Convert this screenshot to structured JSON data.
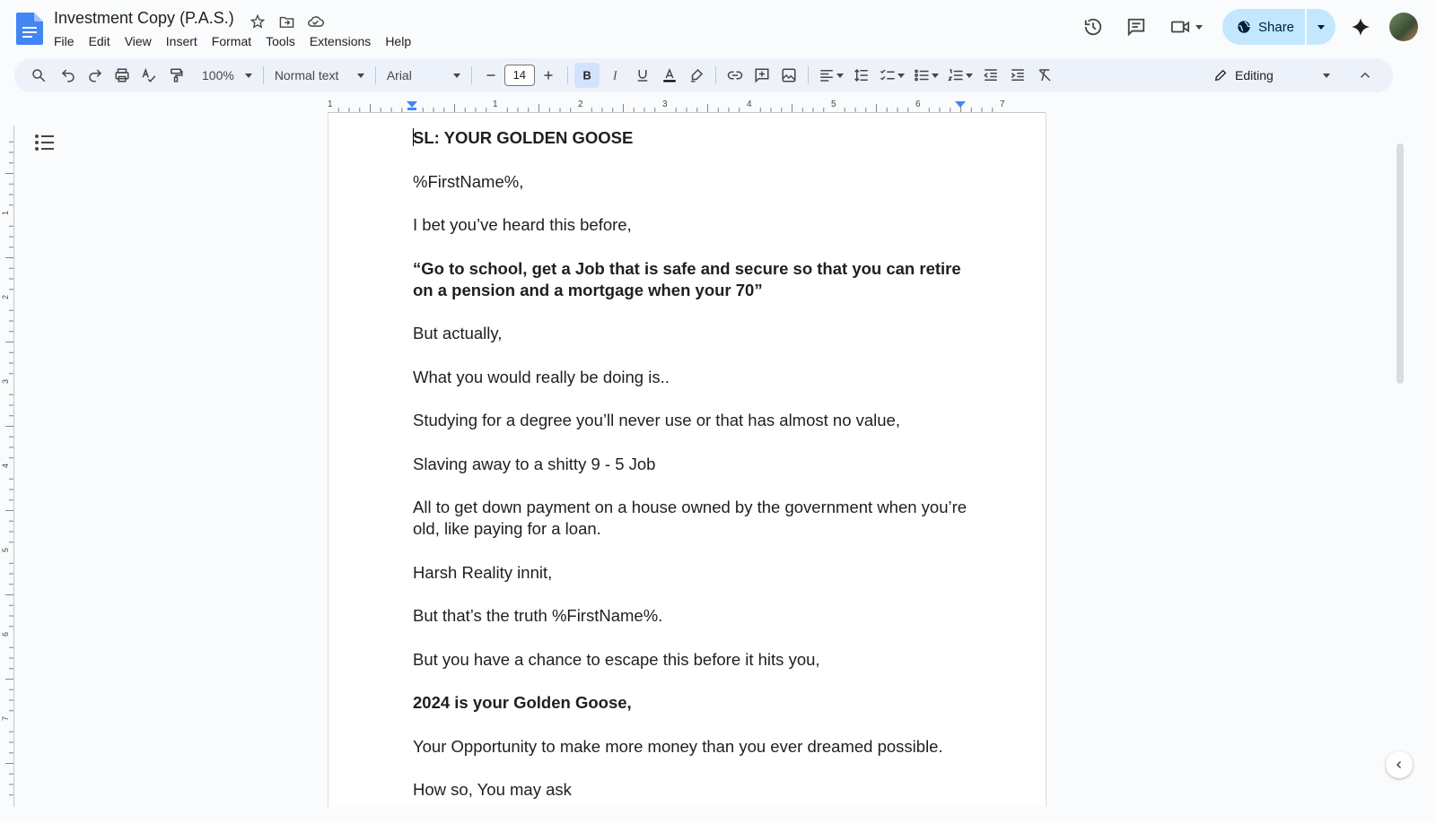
{
  "app": {
    "doc_title": "Investment Copy (P.A.S.)",
    "menu": [
      "File",
      "Edit",
      "View",
      "Insert",
      "Format",
      "Tools",
      "Extensions",
      "Help"
    ],
    "share_label": "Share"
  },
  "toolbar": {
    "zoom": "100%",
    "style": "Normal text",
    "font": "Arial",
    "font_size": "14",
    "mode": "Editing"
  },
  "ruler": {
    "h_ticks": [
      "1",
      "1",
      "2",
      "3",
      "4",
      "5",
      "6",
      "7"
    ],
    "v_ticks": [
      "1",
      "2",
      "3",
      "4",
      "5",
      "6",
      "7"
    ]
  },
  "document": {
    "paragraphs": [
      {
        "text": "SL: YOUR GOLDEN GOOSE",
        "bold": true
      },
      {
        "text": "%FirstName%,",
        "bold": false
      },
      {
        "text": "I bet you’ve heard this before,",
        "bold": false
      },
      {
        "text": "“Go to school, get a Job that is safe and secure so that you can retire on a pension and a mortgage when your 70”",
        "bold": true
      },
      {
        "text": "But actually,",
        "bold": false
      },
      {
        "text": "What you would really be doing is..",
        "bold": false
      },
      {
        "text": "Studying for a degree you’ll never use or that has almost no value,",
        "bold": false
      },
      {
        "text": "Slaving away to a shitty 9 - 5 Job",
        "bold": false
      },
      {
        "text": "All to get down payment on a house owned by the government when you’re old, like paying for a loan.",
        "bold": false
      },
      {
        "text": "Harsh Reality innit,",
        "bold": false
      },
      {
        "text": "But that’s the truth %FirstName%.",
        "bold": false
      },
      {
        "text": "But you have a chance to escape this before it hits you,",
        "bold": false
      },
      {
        "text": "2024 is your Golden Goose,",
        "bold": true
      },
      {
        "text": "Your Opportunity to make more money than you ever dreamed possible.",
        "bold": false
      },
      {
        "text": "How so, You may ask",
        "bold": false
      }
    ]
  },
  "colors": {
    "accent": "#1a73e8",
    "share_bg": "#c2e7ff",
    "toolbar_bg": "#edf2fa",
    "bold_active": "#d3e3fd"
  }
}
